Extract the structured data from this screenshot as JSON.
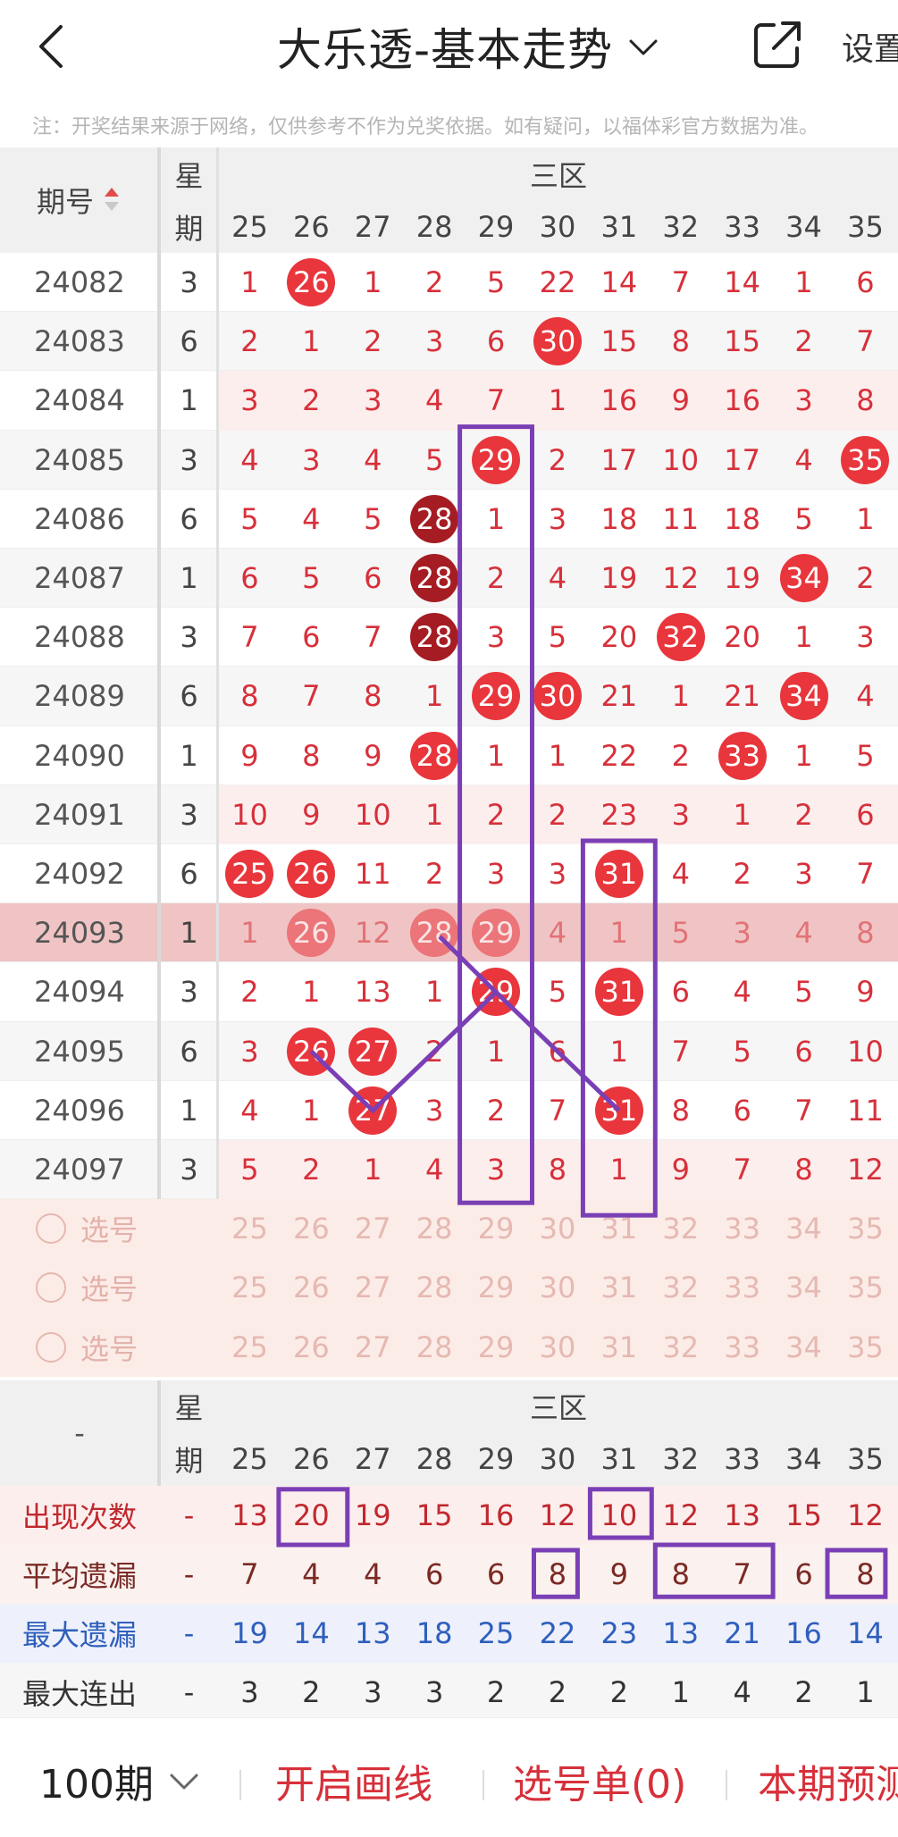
{
  "header": {
    "title": "大乐透-基本走势",
    "settings_label": "设置"
  },
  "notice": "注：开奖结果来源于网络，仅供参考不作为兑奖依据。如有疑问，以福体彩官方数据为准。",
  "table": {
    "period_header": "期号",
    "week_header_1": "星",
    "week_header_2": "期",
    "zone_label": "三区",
    "columns": [
      25,
      26,
      27,
      28,
      29,
      30,
      31,
      32,
      33,
      34,
      35
    ],
    "rows": [
      {
        "period": "24082",
        "week": "3",
        "cells": [
          1,
          26,
          1,
          2,
          5,
          22,
          14,
          7,
          14,
          1,
          6
        ],
        "hits": [
          26
        ]
      },
      {
        "period": "24083",
        "week": "6",
        "cells": [
          2,
          1,
          2,
          3,
          6,
          30,
          15,
          8,
          15,
          2,
          7
        ],
        "hits": [
          30
        ]
      },
      {
        "period": "24084",
        "week": "1",
        "cells": [
          3,
          2,
          3,
          4,
          7,
          1,
          16,
          9,
          16,
          3,
          8
        ],
        "hits": []
      },
      {
        "period": "24085",
        "week": "3",
        "cells": [
          4,
          3,
          4,
          5,
          29,
          2,
          17,
          10,
          17,
          4,
          35
        ],
        "hits": [
          29,
          35
        ]
      },
      {
        "period": "24086",
        "week": "6",
        "cells": [
          5,
          4,
          5,
          28,
          1,
          3,
          18,
          11,
          18,
          5,
          1
        ],
        "hits": [
          28
        ]
      },
      {
        "period": "24087",
        "week": "1",
        "cells": [
          6,
          5,
          6,
          28,
          2,
          4,
          19,
          12,
          19,
          34,
          2
        ],
        "hits": [
          28,
          34
        ]
      },
      {
        "period": "24088",
        "week": "3",
        "cells": [
          7,
          6,
          7,
          28,
          3,
          5,
          20,
          32,
          20,
          1,
          3
        ],
        "hits": [
          28,
          32
        ]
      },
      {
        "period": "24089",
        "week": "6",
        "cells": [
          8,
          7,
          8,
          1,
          29,
          30,
          21,
          1,
          21,
          34,
          4
        ],
        "hits": [
          29,
          30,
          34
        ]
      },
      {
        "period": "24090",
        "week": "1",
        "cells": [
          9,
          8,
          9,
          28,
          1,
          1,
          22,
          2,
          33,
          1,
          5
        ],
        "hits": [
          28,
          33
        ]
      },
      {
        "period": "24091",
        "week": "3",
        "cells": [
          10,
          9,
          10,
          1,
          2,
          2,
          23,
          3,
          1,
          2,
          6
        ],
        "hits": []
      },
      {
        "period": "24092",
        "week": "6",
        "cells": [
          25,
          26,
          11,
          2,
          3,
          3,
          31,
          4,
          2,
          3,
          7
        ],
        "hits": [
          25,
          26,
          31
        ]
      },
      {
        "period": "24093",
        "week": "1",
        "cells": [
          1,
          26,
          12,
          28,
          29,
          4,
          1,
          5,
          3,
          4,
          8
        ],
        "hits": [
          26,
          28,
          29
        ]
      },
      {
        "period": "24094",
        "week": "3",
        "cells": [
          2,
          1,
          13,
          1,
          29,
          5,
          31,
          6,
          4,
          5,
          9
        ],
        "hits": [
          29,
          31
        ]
      },
      {
        "period": "24095",
        "week": "6",
        "cells": [
          3,
          26,
          27,
          2,
          1,
          6,
          1,
          7,
          5,
          6,
          10
        ],
        "hits": [
          26,
          27
        ]
      },
      {
        "period": "24096",
        "week": "1",
        "cells": [
          4,
          1,
          27,
          3,
          2,
          7,
          31,
          8,
          6,
          7,
          11
        ],
        "hits": [
          27,
          31
        ]
      },
      {
        "period": "24097",
        "week": "3",
        "cells": [
          5,
          2,
          1,
          4,
          3,
          8,
          1,
          9,
          7,
          8,
          12
        ],
        "hits": []
      }
    ],
    "select_label": "选号",
    "stats": [
      {
        "label": "出现次数",
        "dash": "-",
        "values": [
          13,
          20,
          19,
          15,
          16,
          12,
          10,
          12,
          13,
          15,
          12
        ],
        "color": "#c0282d"
      },
      {
        "label": "平均遗漏",
        "dash": "-",
        "values": [
          7,
          4,
          4,
          6,
          6,
          8,
          9,
          8,
          7,
          6,
          8
        ],
        "color": "#7a2a24"
      },
      {
        "label": "最大遗漏",
        "dash": "-",
        "values": [
          19,
          14,
          13,
          18,
          25,
          22,
          23,
          13,
          21,
          16,
          14
        ],
        "color": "#2f5fbd"
      },
      {
        "label": "最大连出",
        "dash": "-",
        "values": [
          3,
          2,
          3,
          3,
          2,
          2,
          2,
          1,
          4,
          2,
          1
        ],
        "color": "#333333"
      }
    ],
    "stats_corner": "-"
  },
  "bottom_bar": {
    "periods": "100期",
    "draw_lines": "开启画线",
    "selection_list": "选号单(0)",
    "prediction": "本期预测"
  }
}
